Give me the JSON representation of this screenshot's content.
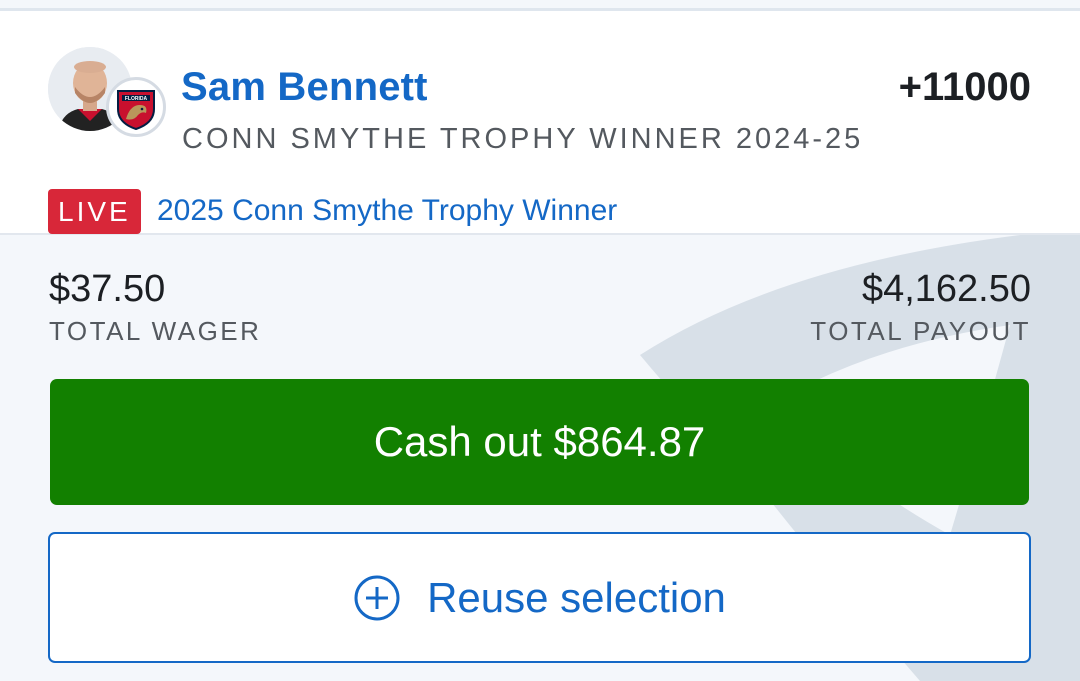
{
  "bet": {
    "player_name": "Sam Bennett",
    "market": "CONN SMYTHE TROPHY WINNER 2024-25",
    "odds": "+11000",
    "live_badge": "LIVE",
    "event_name": "2025 Conn Smythe Trophy Winner",
    "team_logo_text": "FLORIDA"
  },
  "totals": {
    "wager_amount": "$37.50",
    "wager_label": "TOTAL WAGER",
    "payout_amount": "$4,162.50",
    "payout_label": "TOTAL PAYOUT"
  },
  "actions": {
    "cashout_label": "Cash out $864.87",
    "reuse_label": "Reuse selection"
  },
  "colors": {
    "brand_blue": "#1468c6",
    "cashout_green": "#128000",
    "live_red": "#d82739"
  },
  "icons": {
    "reuse": "plus-circle-icon",
    "team": "florida-panthers-logo"
  }
}
